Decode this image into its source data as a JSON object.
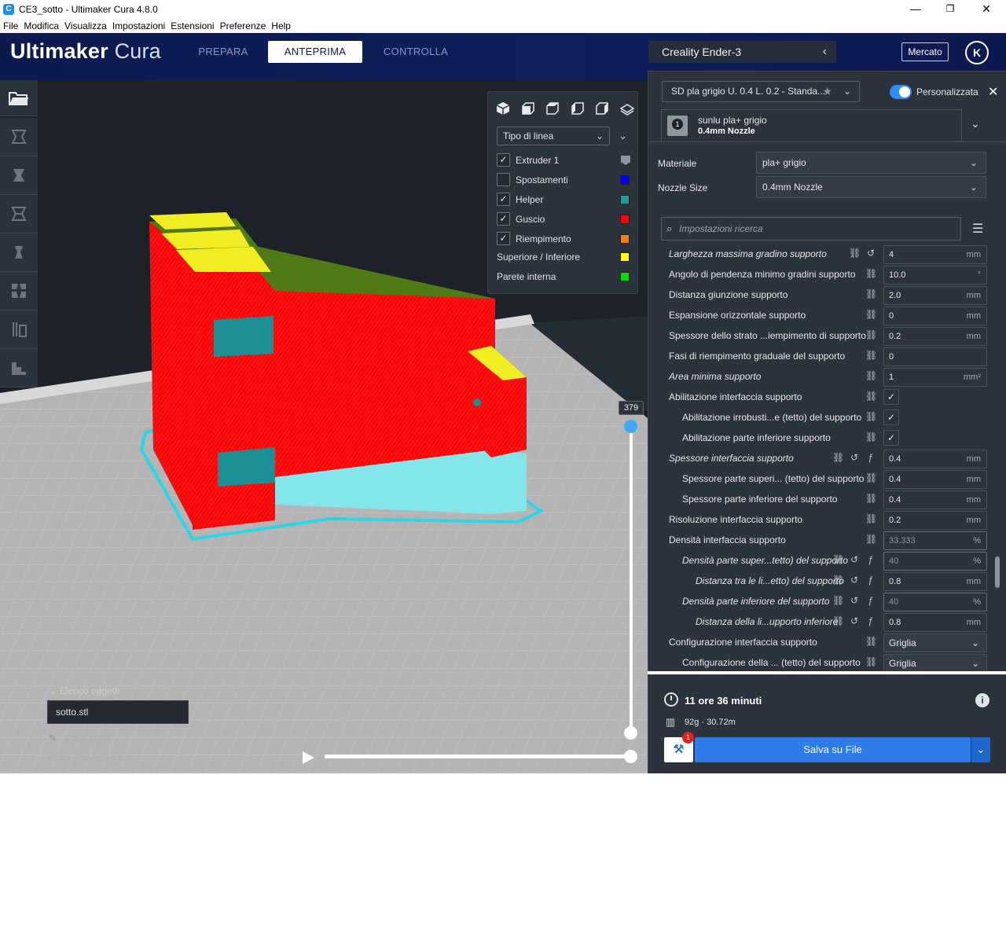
{
  "window": {
    "title": "CE3_sotto - Ultimaker Cura 4.8.0",
    "minimize": "—",
    "maximize": "❐",
    "close": "✕"
  },
  "menubar": [
    "File",
    "Modifica",
    "Visualizza",
    "Impostazioni",
    "Estensioni",
    "Preferenze",
    "Help"
  ],
  "header": {
    "logo_brand": "Ultimaker",
    "logo_product": "Cura",
    "tabs": [
      {
        "label": "PREPARA",
        "active": false
      },
      {
        "label": "ANTEPRIMA",
        "active": true
      },
      {
        "label": "CONTROLLA",
        "active": false
      }
    ],
    "printer": "Creality Ender-3",
    "marketplace": "Mercato",
    "account_initial": "K"
  },
  "legend": {
    "line_type": "Tipo di linea",
    "items": [
      {
        "label": "Extruder 1",
        "checked": true,
        "color": "#8f969e",
        "has_checkbox": true
      },
      {
        "label": "Spostamenti",
        "checked": false,
        "color": "#0000ff",
        "has_checkbox": true
      },
      {
        "label": "Helper",
        "checked": true,
        "color": "#1f9a9a",
        "has_checkbox": true
      },
      {
        "label": "Guscio",
        "checked": true,
        "color": "#ff0000",
        "has_checkbox": true
      },
      {
        "label": "Riempimento",
        "checked": true,
        "color": "#ee7f1b",
        "has_checkbox": true
      },
      {
        "label": "Superiore / Inferiore",
        "checked": false,
        "color": "#ffff00",
        "has_checkbox": false
      },
      {
        "label": "Parete interna",
        "checked": false,
        "color": "#00dd00",
        "has_checkbox": false
      }
    ]
  },
  "layer_slider": {
    "current_layer": "379"
  },
  "object_list": {
    "heading": "Elenco oggetti",
    "item": "sotto.stl",
    "job_name": "CE3_sotto",
    "dimensions": "92.5 x 78.0 x 76.0 mm"
  },
  "panel": {
    "profile": "SD pla grigio U. 0.4 L. 0.2 - Standa...",
    "custom_mode": "Personalizzata",
    "extruder_material": "sunlu pla+ grigio",
    "extruder_nozzle": "0.4mm Nozzle",
    "extruder_number": "1",
    "material_label": "Materiale",
    "material_value": "pla+ grigio",
    "nozzle_label": "Nozzle Size",
    "nozzle_value": "0.4mm Nozzle",
    "search_placeholder": "Impostazioni ricerca"
  },
  "settings": [
    {
      "label": "Larghezza massima gradino supporto",
      "italic": true,
      "indent": 0,
      "icons": [
        "link",
        "reset"
      ],
      "type": "value",
      "value": "4",
      "unit": "mm"
    },
    {
      "label": "Angolo di pendenza minimo gradini supporto",
      "italic": false,
      "indent": 0,
      "icons": [
        "link"
      ],
      "type": "value",
      "value": "10.0",
      "unit": "°"
    },
    {
      "label": "Distanza giunzione supporto",
      "italic": false,
      "indent": 0,
      "icons": [
        "link"
      ],
      "type": "value",
      "value": "2.0",
      "unit": "mm"
    },
    {
      "label": "Espansione orizzontale supporto",
      "italic": false,
      "indent": 0,
      "icons": [
        "link"
      ],
      "type": "value",
      "value": "0",
      "unit": "mm"
    },
    {
      "label": "Spessore dello strato ...iempimento di supporto",
      "italic": false,
      "indent": 0,
      "icons": [
        "link"
      ],
      "type": "value",
      "value": "0.2",
      "unit": "mm"
    },
    {
      "label": "Fasi di riempimento graduale del supporto",
      "italic": false,
      "indent": 0,
      "icons": [
        "link"
      ],
      "type": "value",
      "value": "0",
      "unit": ""
    },
    {
      "label": "Area minima supporto",
      "italic": true,
      "indent": 0,
      "icons": [
        "link"
      ],
      "type": "value",
      "value": "1",
      "unit": "mm²"
    },
    {
      "label": "Abilitazione interfaccia supporto",
      "italic": false,
      "indent": 0,
      "icons": [
        "link"
      ],
      "type": "check",
      "value": "✓",
      "unit": ""
    },
    {
      "label": "Abilitazione irrobusti...e (tetto) del supporto",
      "italic": false,
      "indent": 1,
      "icons": [
        "link"
      ],
      "type": "check",
      "value": "✓",
      "unit": ""
    },
    {
      "label": "Abilitazione parte inferiore supporto",
      "italic": false,
      "indent": 1,
      "icons": [
        "link"
      ],
      "type": "check",
      "value": "✓",
      "unit": ""
    },
    {
      "label": "Spessore interfaccia supporto",
      "italic": true,
      "indent": 0,
      "icons": [
        "link",
        "reset",
        "fx"
      ],
      "type": "value",
      "value": "0.4",
      "unit": "mm"
    },
    {
      "label": "Spessore parte superi... (tetto) del supporto",
      "italic": false,
      "indent": 1,
      "icons": [
        "link"
      ],
      "type": "value",
      "value": "0.4",
      "unit": "mm"
    },
    {
      "label": "Spessore parte inferiore del supporto",
      "italic": false,
      "indent": 1,
      "icons": [
        "link"
      ],
      "type": "value",
      "value": "0.4",
      "unit": "mm"
    },
    {
      "label": "Risoluzione interfaccia supporto",
      "italic": false,
      "indent": 0,
      "icons": [
        "link"
      ],
      "type": "value",
      "value": "0.2",
      "unit": "mm"
    },
    {
      "label": "Densità interfaccia supporto",
      "italic": false,
      "indent": 0,
      "icons": [
        "link"
      ],
      "type": "value",
      "value": "33.333",
      "unit": "%",
      "dim": true
    },
    {
      "label": "Densità parte super...tetto) del supporto",
      "italic": true,
      "indent": 1,
      "icons": [
        "link",
        "reset",
        "fx"
      ],
      "type": "value",
      "value": "40",
      "unit": "%",
      "dim": true
    },
    {
      "label": "Distanza tra le li...etto) del supporto",
      "italic": true,
      "indent": 2,
      "icons": [
        "link",
        "reset",
        "fx"
      ],
      "type": "value",
      "value": "0.8",
      "unit": "mm"
    },
    {
      "label": "Densità parte inferiore del supporto",
      "italic": true,
      "indent": 1,
      "icons": [
        "link",
        "reset",
        "fx"
      ],
      "type": "value",
      "value": "40",
      "unit": "%",
      "dim": true
    },
    {
      "label": "Distanza della li...upporto inferiore",
      "italic": true,
      "indent": 2,
      "icons": [
        "link",
        "reset",
        "fx"
      ],
      "type": "value",
      "value": "0.8",
      "unit": "mm"
    },
    {
      "label": "Configurazione interfaccia supporto",
      "italic": false,
      "indent": 0,
      "icons": [
        "link"
      ],
      "type": "dropdown",
      "value": "Griglia",
      "unit": ""
    },
    {
      "label": "Configurazione della ... (tetto) del supporto",
      "italic": false,
      "indent": 1,
      "icons": [
        "link"
      ],
      "type": "dropdown",
      "value": "Griglia",
      "unit": ""
    }
  ],
  "summary": {
    "print_time": "11 ore 36 minuti",
    "material_usage": "92g · 30.72m",
    "save_label": "Salva su File",
    "notification_count": "1"
  }
}
